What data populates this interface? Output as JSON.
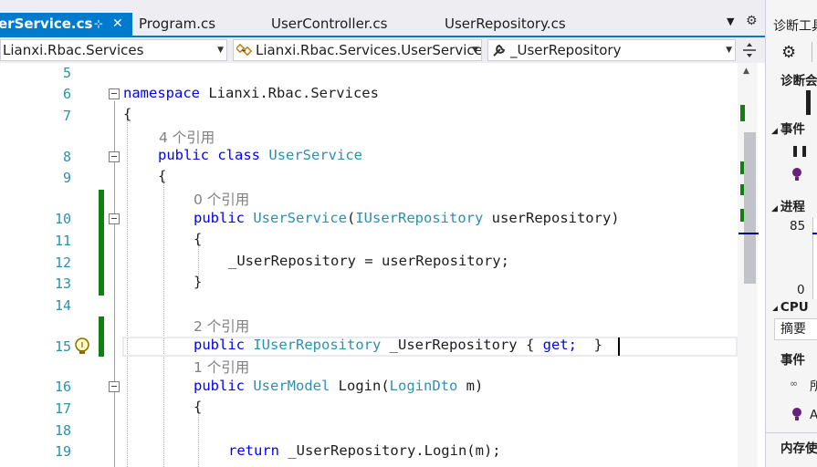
{
  "tabs": [
    {
      "label": "erService.cs",
      "pin": "⊹",
      "close": "✕",
      "active": true
    },
    {
      "label": "Program.cs",
      "active": false
    },
    {
      "label": "UserController.cs",
      "active": false
    },
    {
      "label": "UserRepository.cs",
      "active": false
    }
  ],
  "tabstrip": {
    "dropdown_icon": "▼",
    "settings_icon": "⚙"
  },
  "navbar": {
    "project": "Lianxi.Rbac.Services",
    "type": "Lianxi.Rbac.Services.UserService",
    "member": "_UserRepository",
    "dropdown_arrow": "▼"
  },
  "line_numbers": [
    "5",
    "6",
    "7",
    "8",
    "9",
    "10",
    "11",
    "12",
    "13",
    "14",
    "15",
    "16",
    "17",
    "18",
    "19"
  ],
  "code": {
    "l6_kw": "namespace",
    "l6_id": " Lianxi.Rbac.Services",
    "l7": "{",
    "ref_class": "4 个引用",
    "l8_kw1": "public",
    "l8_kw2": "class",
    "l8_ty": "UserService",
    "l9": "{",
    "ref_ctor": "0 个引用",
    "l10_kw": "public",
    "l10_ty": "UserService",
    "l10_p1": "(",
    "l10_ty2": "IUserRepository",
    "l10_id": " userRepository)",
    "l11": "{",
    "l12_id": "_UserRepository = userRepository;",
    "l13": "}",
    "ref_prop": "2 个引用",
    "l15_kw": "public",
    "l15_ty": "IUserRepository",
    "l15_id": " _UserRepository ",
    "l15_b1": "{",
    "l15_kw2": " get;",
    "l15_b2": "  }",
    "ref_login": "1 个引用",
    "l16_kw": "public",
    "l16_ty": "UserModel",
    "l16_id1": " Login(",
    "l16_ty2": "LoginDto",
    "l16_id2": " m)",
    "l17": "{",
    "l19_kw": "return",
    "l19_id": " _UserRepository.Login(m);"
  },
  "diagnostics": {
    "title": "诊断工具",
    "session": "诊断会",
    "events_header": "事件",
    "process_header": "进程",
    "chart_max": "85",
    "chart_min": "0",
    "cpu_label": "CPU",
    "summary_tab": "摘要",
    "events_label": "事件",
    "events_item1": "所",
    "events_item2": "A",
    "memory_label": "内存使",
    "pause_icon": "❚❚",
    "collapse_icon": "◢"
  },
  "colors": {
    "accent": "#007acc",
    "keyword": "#0000ff",
    "type": "#2b91af",
    "line_number": "#2b91af",
    "change_bar": "#108010",
    "reference": "#808080"
  }
}
